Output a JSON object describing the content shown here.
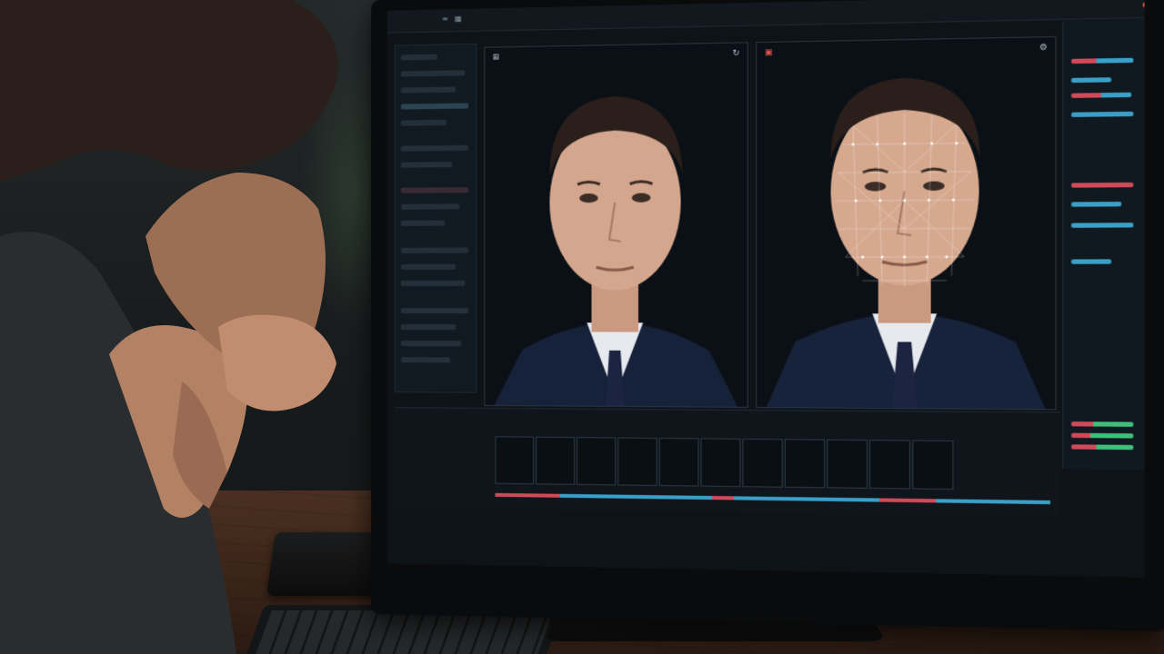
{
  "scene": {
    "description_tag": "",
    "monitor": {
      "topbar_title": "",
      "left_viewer_icons": [
        "mesh-icon",
        "grid-icon"
      ],
      "right_viewer_icons": [
        "record-icon",
        "settings-icon"
      ]
    },
    "colors": {
      "accent_blue": "#3aa0c8",
      "accent_red": "#d04a5a",
      "accent_green": "#3fbf7a",
      "panel_bg": "#121a21",
      "screen_bg": "#0e1318",
      "desk_wood": "#3a2418"
    },
    "filmstrip": {
      "thumbnail_count": 11
    }
  }
}
